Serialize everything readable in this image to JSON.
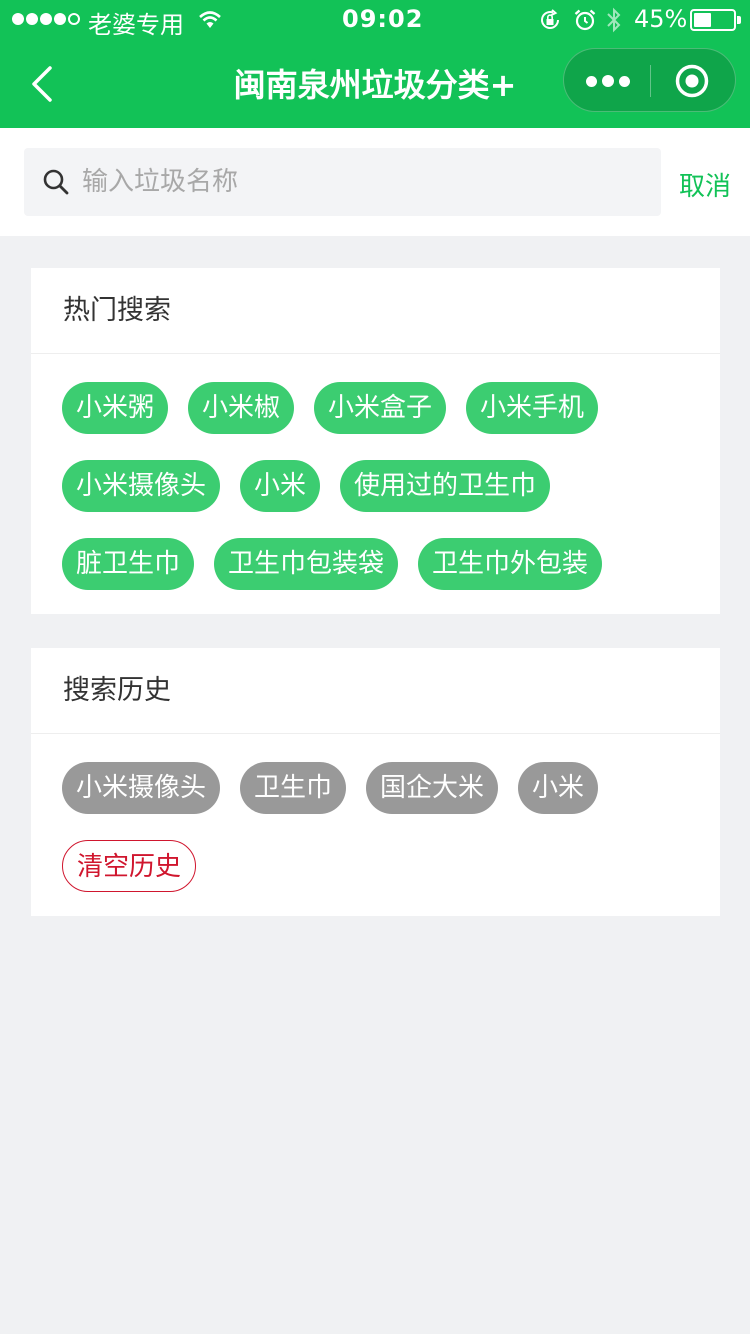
{
  "status_bar": {
    "carrier": "老婆专用",
    "time": "09:02",
    "battery_text": "45%",
    "battery_level": 0.45
  },
  "nav": {
    "title": "闽南泉州垃圾分类+"
  },
  "search": {
    "placeholder": "输入垃圾名称",
    "value": "",
    "cancel_label": "取消"
  },
  "hot_search": {
    "title": "热门搜索",
    "tags": [
      "小米粥",
      "小米椒",
      "小米盒子",
      "小米手机",
      "小米摄像头",
      "小米",
      "使用过的卫生巾",
      "脏卫生巾",
      "卫生巾包装袋",
      "卫生巾外包装"
    ]
  },
  "history": {
    "title": "搜索历史",
    "tags": [
      "小米摄像头",
      "卫生巾",
      "国企大米",
      "小米"
    ],
    "clear_label": "清空历史"
  },
  "colors": {
    "brand_green": "#12c257",
    "tag_green": "#3ccd71",
    "tag_gray": "#999999",
    "clear_red": "#d0162e"
  }
}
